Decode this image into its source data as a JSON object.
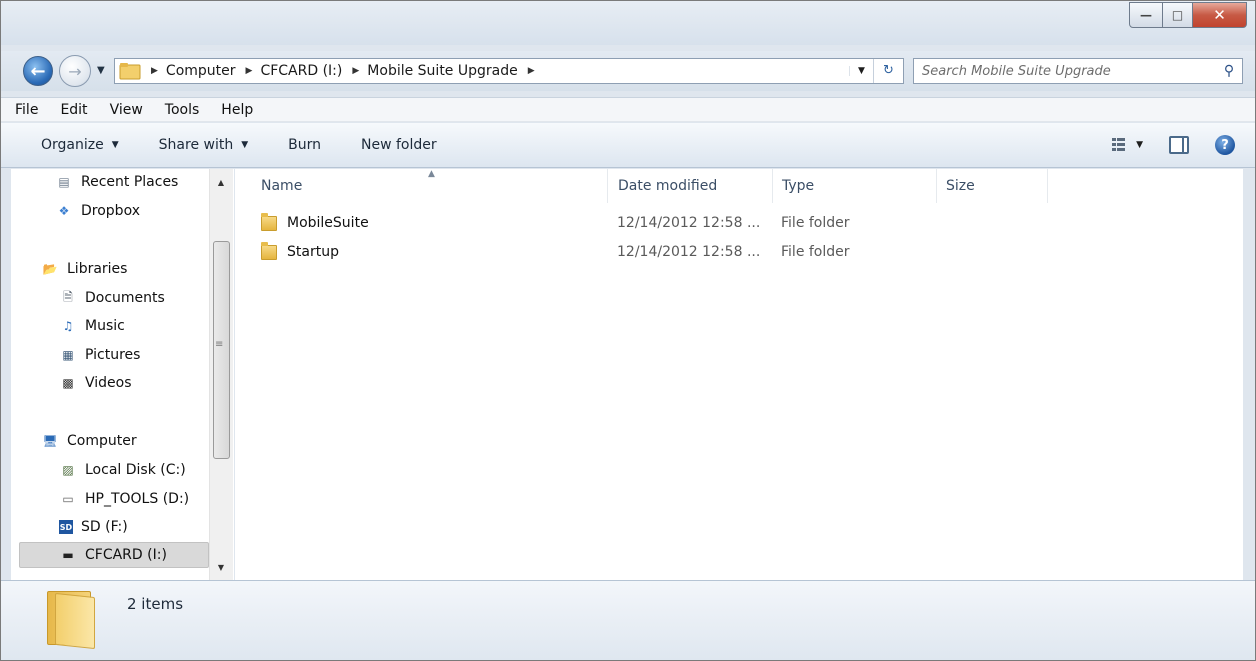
{
  "window": {
    "controls": {
      "minimize": "—",
      "maximize": "□",
      "close": "✕"
    }
  },
  "address_bar": {
    "crumbs": [
      "Computer",
      "CFCARD (I:)",
      "Mobile Suite Upgrade"
    ]
  },
  "search": {
    "placeholder": "Search Mobile Suite Upgrade"
  },
  "menu": {
    "items": [
      "File",
      "Edit",
      "View",
      "Tools",
      "Help"
    ]
  },
  "toolbar": {
    "organize": "Organize",
    "share_with": "Share with",
    "burn": "Burn",
    "new_folder": "New folder"
  },
  "nav_pane": {
    "items": [
      {
        "label": "Recent Places",
        "icon": "recent-places-icon"
      },
      {
        "label": "Dropbox",
        "icon": "dropbox-icon"
      },
      {
        "label": "Libraries",
        "icon": "libraries-icon"
      },
      {
        "label": "Documents",
        "icon": "documents-icon"
      },
      {
        "label": "Music",
        "icon": "music-icon"
      },
      {
        "label": "Pictures",
        "icon": "pictures-icon"
      },
      {
        "label": "Videos",
        "icon": "videos-icon"
      },
      {
        "label": "Computer",
        "icon": "computer-icon"
      },
      {
        "label": "Local Disk (C:)",
        "icon": "local-disk-icon"
      },
      {
        "label": "HP_TOOLS (D:)",
        "icon": "drive-icon"
      },
      {
        "label": "SD (F:)",
        "icon": "sd-card-icon"
      },
      {
        "label": "CFCARD (I:)",
        "icon": "removable-drive-icon",
        "selected": true
      }
    ]
  },
  "columns": {
    "name": "Name",
    "date_modified": "Date modified",
    "type": "Type",
    "size": "Size"
  },
  "files": [
    {
      "name": "MobileSuite",
      "date_modified": "12/14/2012 12:58 ...",
      "type": "File folder",
      "size": ""
    },
    {
      "name": "Startup",
      "date_modified": "12/14/2012 12:58 ...",
      "type": "File folder",
      "size": ""
    }
  ],
  "details": {
    "item_count": "2 items"
  },
  "colors": {
    "accent": "#2a6ab6",
    "selection": "#d9d9d9",
    "folder": "#e5b53f"
  }
}
